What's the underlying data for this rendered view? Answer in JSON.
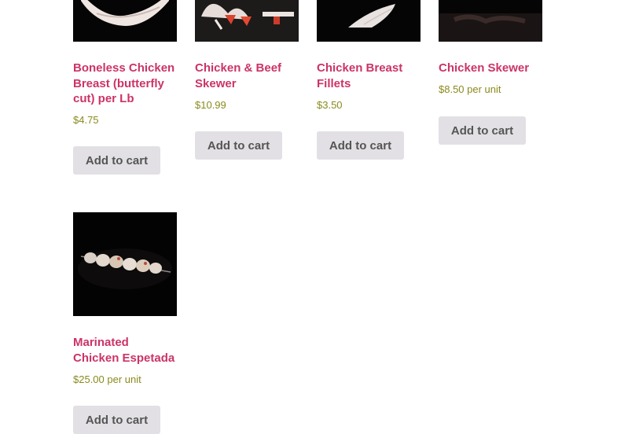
{
  "products": [
    {
      "title": "Boneless Chicken Breast (butterfly cut) per Lb",
      "price": "$4.75",
      "unit": "",
      "button": "Add to cart",
      "image": "raw-chicken-breast-photo"
    },
    {
      "title": "Chicken & Beef Skewer",
      "price": "$10.99",
      "unit": "",
      "button": "Add to cart",
      "image": "chicken-beef-skewer-photo"
    },
    {
      "title": "Chicken Breast Fillets",
      "price": "$3.50",
      "unit": "",
      "button": "Add to cart",
      "image": "chicken-fillet-photo"
    },
    {
      "title": "Chicken Skewer",
      "price": "$8.50",
      "unit": " per unit",
      "button": "Add to cart",
      "image": "chicken-skewer-photo"
    },
    {
      "title": "Marinated Chicken Espetada",
      "price": "$25.00",
      "unit": " per unit",
      "button": "Add to cart",
      "image": "chicken-espetada-photo"
    }
  ],
  "colors": {
    "title": "#cc3366",
    "price": "#8a8a1e",
    "button_bg": "#e2e0e4",
    "button_text": "#555555"
  }
}
